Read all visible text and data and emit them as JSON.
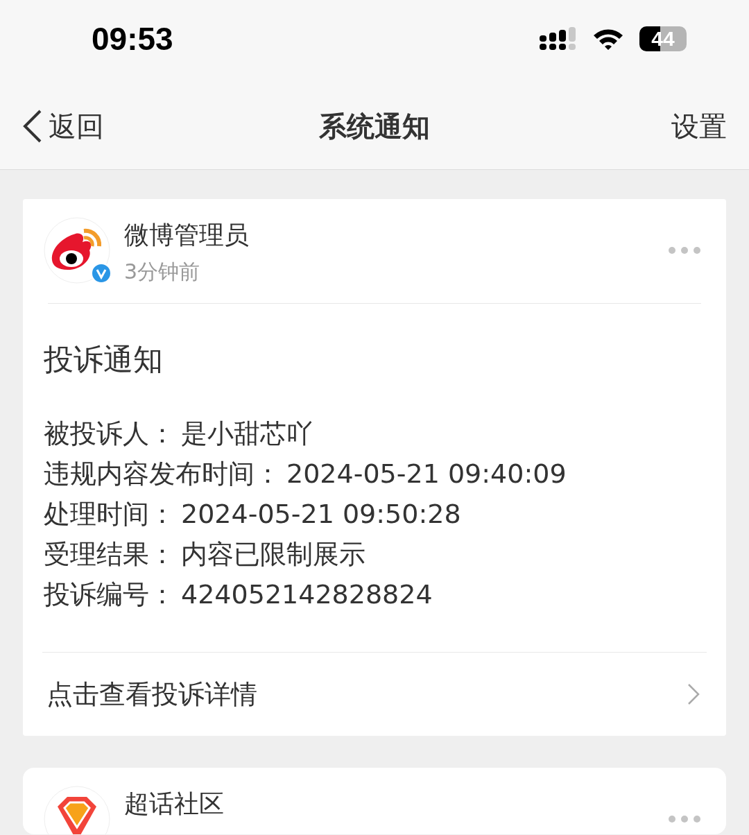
{
  "status_bar": {
    "time": "09:53",
    "battery": "44"
  },
  "nav": {
    "back": "返回",
    "title": "系统通知",
    "action": "设置"
  },
  "notifications": [
    {
      "kind": "weibo",
      "sender": "微博管理员",
      "verified": true,
      "time": "3分钟前",
      "title": "投诉通知",
      "fields": [
        {
          "label": "被投诉人：",
          "value": "是小甜芯吖"
        },
        {
          "label": "违规内容发布时间：",
          "value": "2024-05-21 09:40:09"
        },
        {
          "label": "处理时间：",
          "value": "2024-05-21 09:50:28"
        },
        {
          "label": "受理结果：",
          "value": "内容已限制展示"
        },
        {
          "label": "投诉编号：",
          "value": "424052142828824"
        }
      ],
      "link": "点击查看投诉详情"
    },
    {
      "kind": "supertopic",
      "sender": "超话社区"
    }
  ]
}
